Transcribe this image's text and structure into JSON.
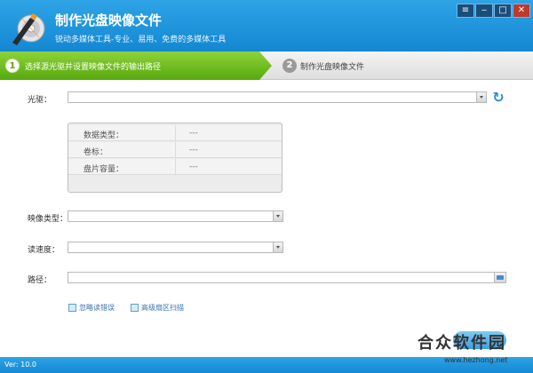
{
  "header": {
    "title": "制作光盘映像文件",
    "subtitle": "锐动多媒体工具-专业、易用、免费的多媒体工具",
    "logo_icon": "disc-pen-icon",
    "window_controls": [
      "menu-icon",
      "minimize-icon",
      "maximize-icon",
      "close-icon"
    ]
  },
  "steps": [
    {
      "number": "1",
      "label": "选择源光驱并设置映像文件的输出路径"
    },
    {
      "number": "2",
      "label": "制作光盘映像文件"
    }
  ],
  "form": {
    "drive_label": "光驱：",
    "drive_value": "",
    "info": [
      {
        "key": "数据类型：",
        "value": "---"
      },
      {
        "key": "卷标：",
        "value": "---"
      },
      {
        "key": "盘片容量：",
        "value": "---"
      }
    ],
    "image_type_label": "映像类型：",
    "image_type_value": "",
    "read_speed_label": "读速度：",
    "read_speed_value": "",
    "path_label": "路径：",
    "path_value": ""
  },
  "options": {
    "ignore_errors": "忽略读错误",
    "advanced_scan": "高级扇区扫描"
  },
  "watermark": {
    "text": "合众软件园",
    "url": "www.hezhong.net"
  },
  "status": {
    "version": "Ver: 10.0"
  },
  "colors": {
    "accent": "#1b93dc",
    "step_active": "#6cbb1a"
  }
}
